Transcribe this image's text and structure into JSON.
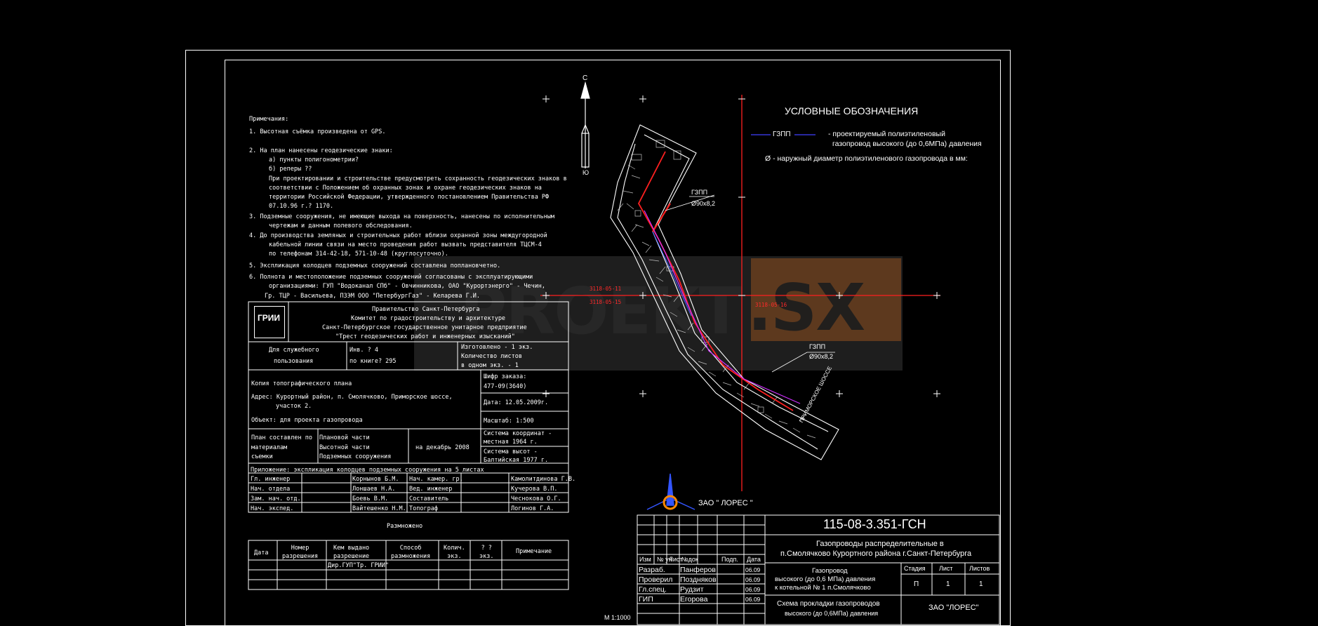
{
  "legend": {
    "title": "УСЛОВНЫЕ  ОБОЗНАЧЕНИЯ",
    "line_label": "ГЗПП",
    "line_desc1": "- проектируемый полиэтиленовый",
    "line_desc2": "газопровод высокого (до 0,6МПа) давления",
    "diam_desc": "Ø - наружный диаметр полиэтиленового газопровода в мм:"
  },
  "compass": {
    "north": "С",
    "south": "Ю"
  },
  "notes": {
    "title": "Примечания:",
    "lines": [
      "1.  Высотная съёмка произведена от GPS.",
      "2.  На план нанесены геодезические знаки:",
      "а)  пункты полигонометрии?",
      "б)  реперы ??",
      "При проектировании и строительстве предусмотреть сохранность геодезических знаков в",
      "соответствии с Положением об охранных зонах и охране геодезических знаков на",
      "территории Российской Федерации, утвержденного постановлением Правительства РФ",
      "07.10.96 г.?    1170.",
      "3.  Подземные сооружения, не имеющие выхода на поверхность, нанесены по исполнительным",
      "чертежам и данным полевого обследования.",
      "4.  До производства земляных и строительных работ вблизи охранной зоны междугородной",
      "кабельной линии связи на место проведения работ вызвать представителя ТЦСМ-4",
      "по телефонам 314-42-18, 571-10-48 (круглосуточно).",
      "5.  Экспликация колодцев подземных сооружений составлена поплановчетно.",
      "6.  Полнота и местоположение подземных сооружений согласованы с эксплуатирующими",
      "организациями: ГУП \"Водоканал СПб\" - Овчинникова, ОАО \"Курортэнерго\" - Чечин,",
      "Гр. ТЦР - Васильева, ПЗЭМ ООО \"ПетербургГаз\" - Келарева Г.И."
    ]
  },
  "stamp": {
    "org1": "Правительство Санкт-Петербурга",
    "org2": "Комитет по градостроительству и архитектуре",
    "org3": "Санкт-Петербургское государственное унитарное предприятие",
    "org4": "\"Трест геодезических работ и инженерных изысканий\"",
    "logo": "ГРИИ",
    "service1": "Для служебного",
    "service2": "пользования",
    "inv1": "Инв. ? 4",
    "inv2": "по книге? 295",
    "made1": "Изготовлено -  1    экз.",
    "made2": "Количество листов",
    "made3": "в одном экз. - 1",
    "copy": "Копия топографического плана",
    "addr1": "Адрес: Курортный район, п. Смолячково, Приморское шоссе,",
    "addr2": "участок 2.",
    "obj": "Объект: для проекта газопровода",
    "order_label": "Шифр заказа:",
    "order": "477-09(3640)",
    "date": "Дата: 12.05.2009г.",
    "scale": "Масштаб: 1:500",
    "plan1": "План составлен по",
    "plan2": "материалам",
    "plan3": "съемки",
    "part1": "Плановой части",
    "part2": "Высотной части",
    "part3": "Подземных сооружения",
    "by_date": "на декабрь 2008",
    "coord1": "Система координат -",
    "coord2": "местная 1964 г.",
    "height1": "Система высот -",
    "height2": "Балтийская 1977 г.",
    "appendix": "Приложение:  экспликация колодцев подземных сооружения на    5   листах",
    "staff": [
      [
        "Гл. инженер",
        "Корнынов Б.М.",
        "Нач. камер. гр.",
        "Камолитдинова Г.В."
      ],
      [
        "Нач. отдела",
        "Лоншаев Н.А.",
        "Вед. инженер",
        "Кучерова В.П."
      ],
      [
        "Зам. нач. отд.",
        "Боевь В.М.",
        "Составитель",
        "Чеснокова О.Г."
      ],
      [
        "Нач. экспед.",
        "Вайтешенко Н.М.",
        "Топограф",
        "Логинов Г.А."
      ]
    ],
    "dup_title": "Размножено",
    "dup_headers": [
      "Дата",
      "Номер\nразрешения",
      "Кем выдано\nразрешение",
      "Способ\nразмножения",
      "Колич.\nэкз.",
      "? ?\nэкз.",
      "Примечание"
    ],
    "dup_issuer": "Дир.ГУП\"Тр. ГРИИ\""
  },
  "map": {
    "grid_a": "3118-05-11",
    "grid_b": "3118-05-15",
    "grid_c": "3118-05-16",
    "pipe1_label": "ГЗПП",
    "pipe1_diam": "Ø90х8,2",
    "pipe2_label": "ГЗПП",
    "pipe2_diam": "Ø90х8,2",
    "road": "ПРИМОРСКОЕ ШОССЕ",
    "company": "ЗАО \" ЛОРЕС \"",
    "scale_note": "М 1:1000"
  },
  "watermark": {
    "left": "PROEKT",
    "right": ".SX"
  },
  "title_block": {
    "code": "115-08-3.351-ГСН",
    "project1": "Газопроводы  распределительные в",
    "project2": "п.Смолячково Курортного района г.Санкт-Петербурга",
    "head": [
      "Изм",
      "№ уч",
      "Лист",
      "№док",
      "Подп.",
      "Дата"
    ],
    "people": [
      [
        "Разраб.",
        "Панферов",
        "06.09"
      ],
      [
        "Проверил",
        "Поздняков",
        "06.09"
      ],
      [
        "Гл.спец.",
        "Рудзит",
        "06.09"
      ],
      [
        "ГИП",
        "Егорова",
        "06.09"
      ]
    ],
    "object1": "Газопровод",
    "object2": "высокого (до 0,6 МПа) давления",
    "object3": "к котельной № 1 п.Смолячково",
    "stage_h": "Стадия",
    "sheet_h": "Лист",
    "sheets_h": "Листов",
    "stage": "П",
    "sheet": "1",
    "sheets": "1",
    "scheme1": "Схема прокладки газопроводов",
    "scheme2": "высокого (до 0,6МПа)  давления",
    "firm": "ЗАО \"ЛОРЕС\""
  },
  "colors": {
    "pipe": "#ff2020",
    "pipe_legend": "#4040ff",
    "frame": "#ffffff",
    "logo": "#3355ff",
    "logo_ring": "#ff8800"
  }
}
